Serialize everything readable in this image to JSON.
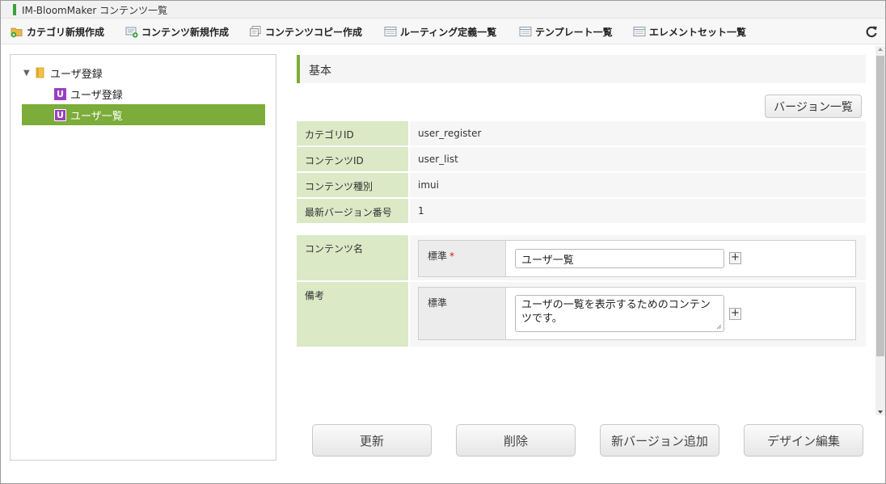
{
  "window": {
    "title": "IM-BloomMaker コンテンツ一覧"
  },
  "toolbar": {
    "items": [
      {
        "label": "カテゴリ新規作成",
        "icon": "folder-plus-icon"
      },
      {
        "label": "コンテンツ新規作成",
        "icon": "document-plus-icon"
      },
      {
        "label": "コンテンツコピー作成",
        "icon": "copy-icon"
      },
      {
        "label": "ルーティング定義一覧",
        "icon": "list-icon"
      },
      {
        "label": "テンプレート一覧",
        "icon": "list-icon"
      },
      {
        "label": "エレメントセット一覧",
        "icon": "list-icon"
      }
    ],
    "refresh_icon": "refresh-icon"
  },
  "tree": {
    "category": {
      "label": "ユーザ登録",
      "icon": "folder-icon",
      "expanded": true
    },
    "items": [
      {
        "label": "ユーザ登録",
        "badge": "U",
        "selected": false
      },
      {
        "label": "ユーザ一覧",
        "badge": "U",
        "selected": true
      }
    ]
  },
  "detail": {
    "section_title": "基本",
    "version_list_button": "バージョン一覧",
    "fields": [
      {
        "label": "カテゴリID",
        "value": "user_register"
      },
      {
        "label": "コンテンツID",
        "value": "user_list"
      },
      {
        "label": "コンテンツ種別",
        "value": "imui"
      },
      {
        "label": "最新バージョン番号",
        "value": "1"
      }
    ],
    "content_name": {
      "label": "コンテンツ名",
      "locale_label": "標準",
      "required_mark": "*",
      "value": "ユーザ一覧"
    },
    "remarks": {
      "label": "備考",
      "locale_label": "標準",
      "value": "ユーザの一覧を表示するためのコンテンツです。"
    },
    "add_label": "+"
  },
  "actions": {
    "update": "更新",
    "delete": "削除",
    "add_version": "新バージョン追加",
    "design_edit": "デザイン編集"
  },
  "colors": {
    "accent": "#7cac39",
    "label_bg": "#dbe9c6",
    "badge": "#9b3fbf"
  }
}
